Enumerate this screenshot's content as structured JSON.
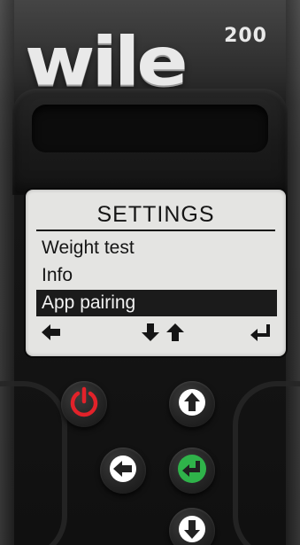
{
  "device": {
    "brand": "wile",
    "model": "200"
  },
  "screen": {
    "title": "SETTINGS",
    "menu_items": [
      {
        "label": "Weight test",
        "selected": false
      },
      {
        "label": "Info",
        "selected": false
      },
      {
        "label": "App pairing",
        "selected": true
      }
    ],
    "softkeys": [
      "arrow-left-icon",
      "arrow-down-icon",
      "arrow-up-icon",
      "enter-icon"
    ]
  },
  "buttons": {
    "power": {
      "icon": "power-icon",
      "color": "#e2222a"
    },
    "up": {
      "icon": "arrow-up-icon",
      "color": "#ffffff"
    },
    "back": {
      "icon": "arrow-left-icon",
      "color": "#ffffff"
    },
    "enter": {
      "icon": "enter-icon",
      "color": "#2fb34a"
    },
    "down": {
      "icon": "arrow-down-icon",
      "color": "#ffffff"
    }
  },
  "colors": {
    "lcd_background": "#e4e4e2",
    "lcd_text": "#151515",
    "selection": "#1b1b1b"
  }
}
